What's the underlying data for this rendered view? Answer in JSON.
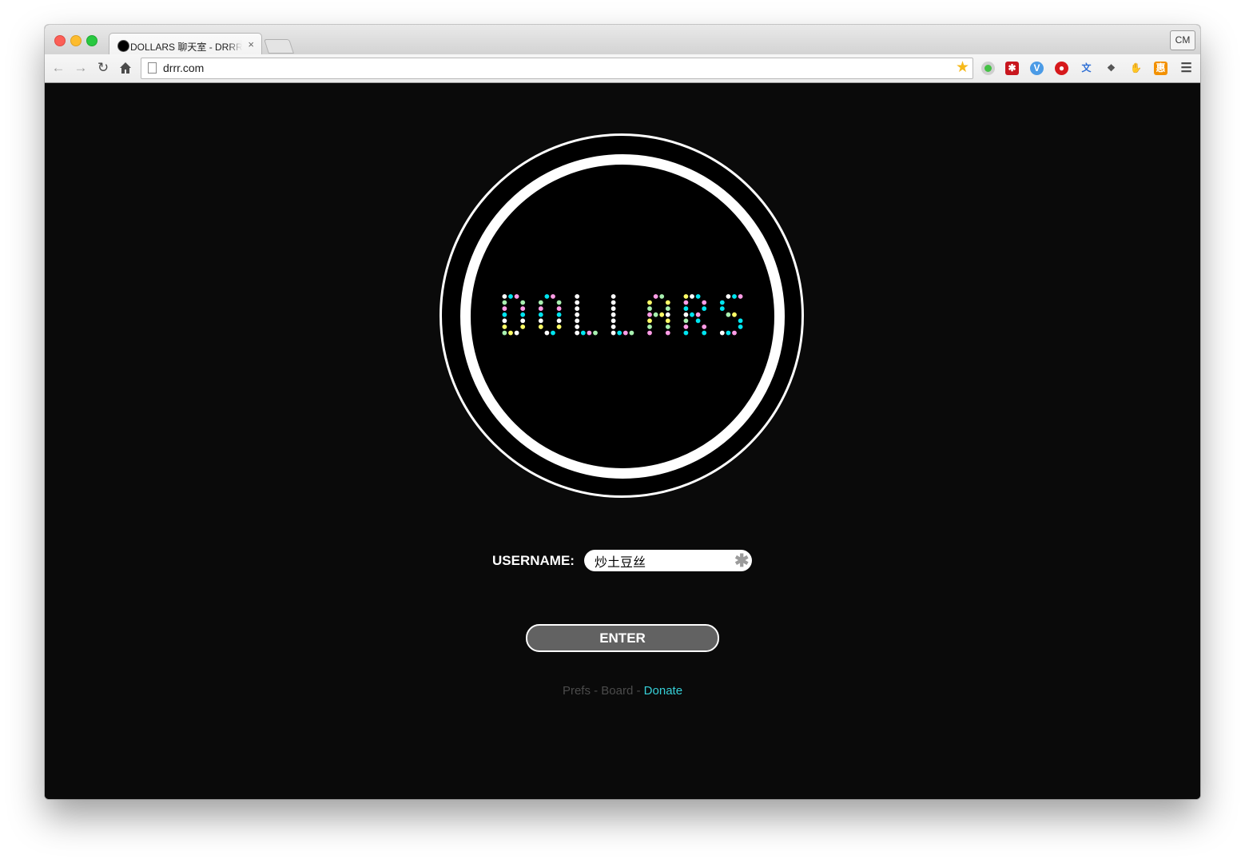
{
  "browser": {
    "tab_title": "DOLLARS 聊天室 - DRRR!!",
    "tab_close": "×",
    "profile_label": "CM",
    "url": "drrr.com",
    "extensions": [
      "green-dot-extension-icon",
      "lastpass-icon",
      "vimium-icon",
      "adblock-icon",
      "translate-icon",
      "evernote-icon",
      "hands-icon",
      "shopping-extension-icon",
      "chrome-menu-icon"
    ]
  },
  "logo": {
    "text": "DOLLARS",
    "dot_colors": [
      "#ffffff",
      "#ff9ce6",
      "#ffff66",
      "#00e5f0",
      "#a8f0b0"
    ]
  },
  "login": {
    "username_label": "USERNAME:",
    "username_value": "炒土豆丝",
    "clear_glyph": "✱",
    "enter_label": "ENTER"
  },
  "footer": {
    "prefs": "Prefs",
    "board": "Board",
    "donate": "Donate",
    "separator": "-",
    "accent_color": "#36d0d8"
  }
}
